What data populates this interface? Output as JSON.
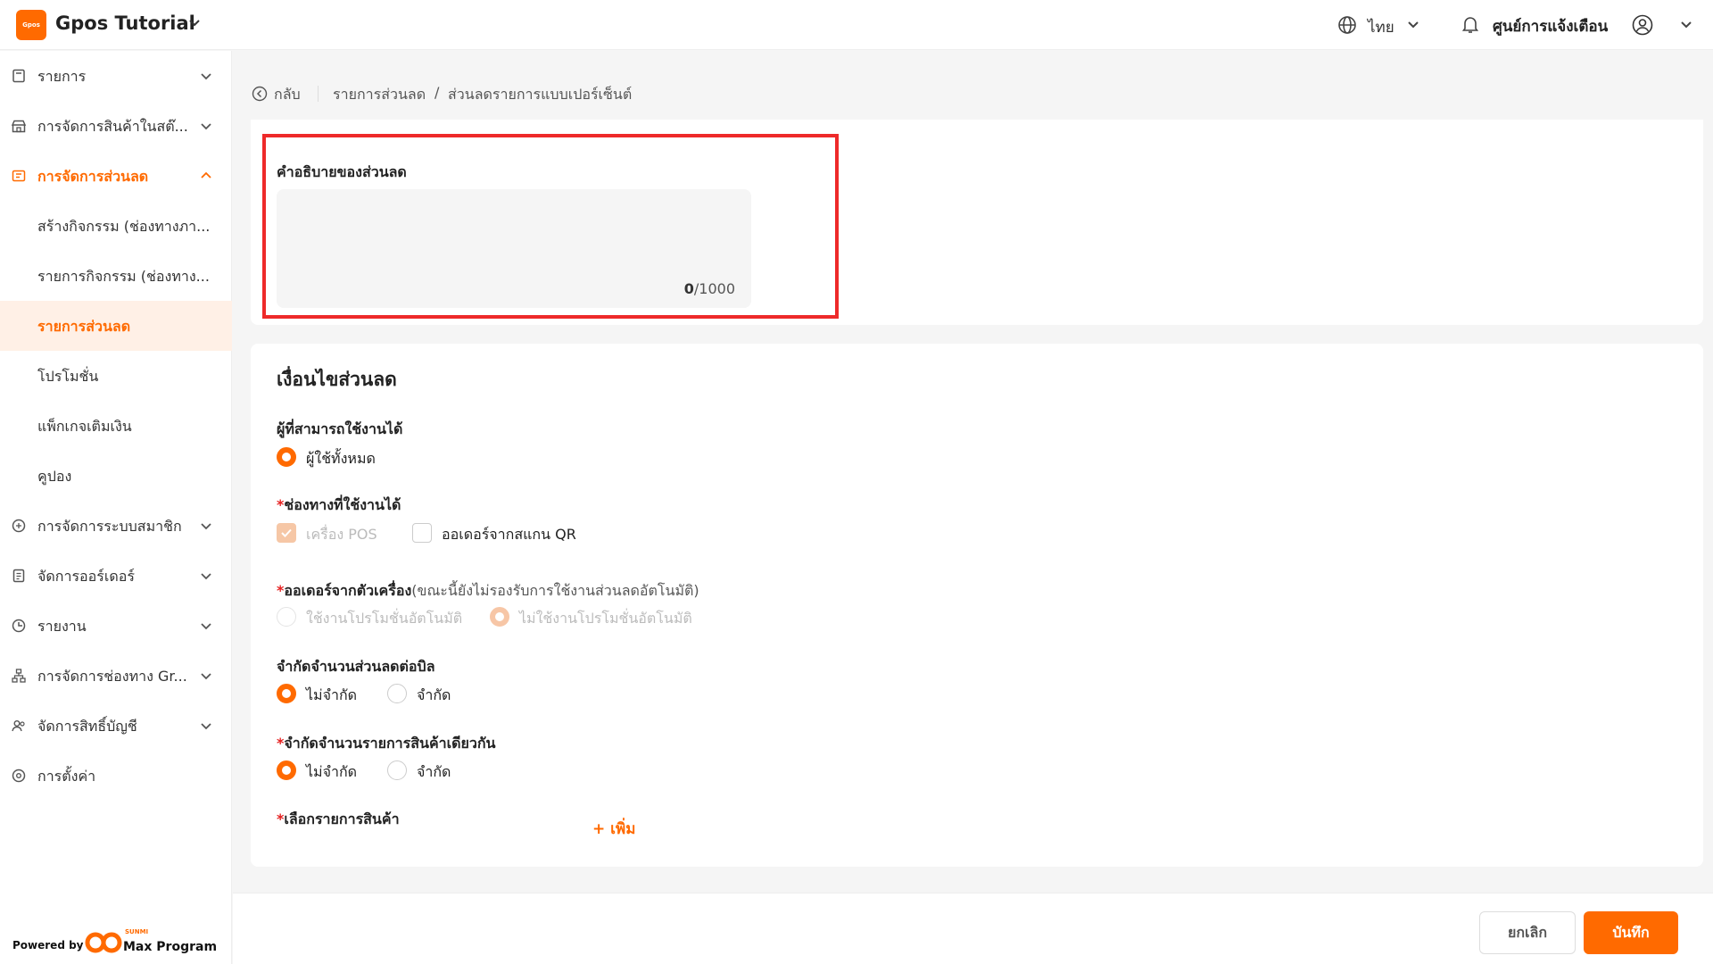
{
  "header": {
    "logo_text": "Gpos",
    "app_title": "Gpos Tutorial",
    "language": "ไทย",
    "notification_center": "ศูนย์การแจ้งเตือน"
  },
  "sidebar": {
    "items": [
      {
        "label": "รายการ",
        "icon": "receipt-icon"
      },
      {
        "label": "การจัดการสินค้าในสต๊...",
        "icon": "store-icon"
      },
      {
        "label": "การจัดการส่วนลด",
        "icon": "discount-icon"
      },
      {
        "label": "สร้างกิจกรรม (ช่องทางภา..."
      },
      {
        "label": "รายการกิจกรรม (ช่องทาง..."
      },
      {
        "label": "รายการส่วนลด"
      },
      {
        "label": "โปรโมชั่น"
      },
      {
        "label": "แพ็กเกจเติมเงิน"
      },
      {
        "label": "คูปอง"
      },
      {
        "label": "การจัดการระบบสมาชิก",
        "icon": "member-icon"
      },
      {
        "label": "จัดการออร์เดอร์",
        "icon": "order-icon"
      },
      {
        "label": "รายงาน",
        "icon": "report-icon"
      },
      {
        "label": "การจัดการช่องทาง Gr...",
        "icon": "channel-icon"
      },
      {
        "label": "จัดการสิทธิ์บัญชี",
        "icon": "users-icon"
      },
      {
        "label": "การตั้งค่า",
        "icon": "settings-icon"
      }
    ],
    "powered_by": "Powered by",
    "brand_small": "SUNMI",
    "brand_name": "Max Program"
  },
  "breadcrumb": {
    "back": "กลับ",
    "level1": "รายการส่วนลด",
    "separator": "/",
    "level2": "ส่วนลดรายการแบบเปอร์เซ็นต์"
  },
  "description": {
    "label": "คำอธิบายของส่วนลด",
    "value": "",
    "count_current": "0",
    "count_max": "/1000"
  },
  "conditions": {
    "title": "เงื่อนไขส่วนลด",
    "users_label": "ผู้ที่สามารถใช้งานได้",
    "users_option": "ผู้ใช้ทั้งหมด",
    "channels_label": "ช่องทางที่ใช้งานได้",
    "channel_pos": "เครื่อง POS",
    "channel_qr": "ออเดอร์จากสแกน QR",
    "device_order_label": "ออเดอร์จากตัวเครื่อง",
    "device_order_note": "(ขณะนี้ยังไม่รองรับการใช้งานส่วนลดอัตโนมัติ)",
    "auto_promo_use": "ใช้งานโปรโมชั่นอัตโนมัติ",
    "auto_promo_nouse": "ไม่ใช้งานโปรโมชั่นอัตโนมัติ",
    "limit_bill_label": "จำกัดจำนวนส่วนลดต่อบิล",
    "limit_item_label": "จำกัดจำนวนรายการสินค้าเดียวกัน",
    "unlimited": "ไม่จำกัด",
    "limited": "จำกัด",
    "select_items_label": "เลือกรายการสินค้า",
    "add": "เพิ่ม",
    "required_mark": "*"
  },
  "footer": {
    "cancel": "ยกเลิก",
    "save": "บันทึก"
  },
  "colors": {
    "accent": "#ff6a00",
    "highlight": "#ee2a2a"
  }
}
